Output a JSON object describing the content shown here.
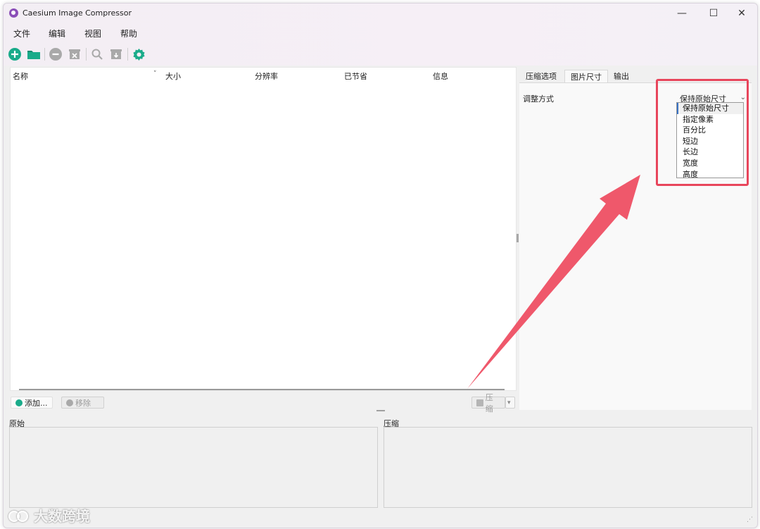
{
  "window": {
    "title": "Caesium Image Compressor",
    "controls": {
      "minimize": "—",
      "maximize": "☐",
      "close": "✕"
    }
  },
  "menu": [
    "文件",
    "编辑",
    "视图",
    "帮助"
  ],
  "toolbar": {
    "icons": [
      "add-icon",
      "open-folder-icon",
      "remove-icon",
      "clear-icon",
      "search-icon",
      "export-icon",
      "settings-icon"
    ],
    "accent": "#1aab8a"
  },
  "table": {
    "columns": [
      "名称",
      "大小",
      "分辨率",
      "已节省",
      "信息"
    ],
    "sort_indicator": "˅"
  },
  "buttons": {
    "add": "添加...",
    "remove": "移除",
    "compress": "压缩"
  },
  "tabs": {
    "items": [
      "压缩选项",
      "图片尺寸",
      "输出"
    ],
    "active": "图片尺寸"
  },
  "resize": {
    "label": "调整方式",
    "selected": "保持原始尺寸",
    "options": [
      "保持原始尺寸",
      "指定像素",
      "百分比",
      "短边",
      "长边",
      "宽度",
      "高度"
    ]
  },
  "previews": {
    "original": "原始",
    "compressed": "压缩"
  },
  "watermark": {
    "text": "大数跨境"
  },
  "colors": {
    "highlight": "#e8465c",
    "arrow": "#ee4f63"
  }
}
